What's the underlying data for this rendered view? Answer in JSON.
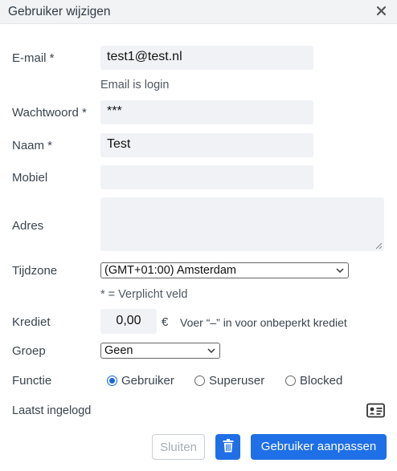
{
  "dialog": {
    "title": "Gebruiker wijzigen"
  },
  "form": {
    "email": {
      "label": "E-mail *",
      "value": "test1@test.nl",
      "hint": "Email is login"
    },
    "password": {
      "label": "Wachtwoord *",
      "value": "***"
    },
    "name": {
      "label": "Naam *",
      "value": "Test"
    },
    "mobile": {
      "label": "Mobiel",
      "value": ""
    },
    "address": {
      "label": "Adres",
      "value": ""
    },
    "timezone": {
      "label": "Tijdzone",
      "value": "(GMT+01:00) Amsterdam"
    },
    "required_note": "* = Verplicht veld",
    "credit": {
      "label": "Krediet",
      "value": "0,00",
      "currency": "€",
      "hint": "Voer “–” in voor onbeperkt krediet"
    },
    "group": {
      "label": "Groep",
      "value": "Geen"
    },
    "function": {
      "label": "Functie",
      "options": [
        {
          "label": "Gebruiker",
          "checked": true
        },
        {
          "label": "Superuser",
          "checked": false
        },
        {
          "label": "Blocked",
          "checked": false
        }
      ]
    },
    "last_login": {
      "label": "Laatst ingelogd",
      "value": ""
    }
  },
  "footer": {
    "close_label": "Sluiten",
    "save_label": "Gebruiker aanpassen"
  },
  "icons": {
    "close": "close-icon",
    "delete": "trash-icon",
    "contact_card": "contact-card-icon"
  },
  "colors": {
    "primary": "#1f6fe6",
    "field_bg": "#f0f2f5",
    "radio_checked": "#1565e0"
  }
}
